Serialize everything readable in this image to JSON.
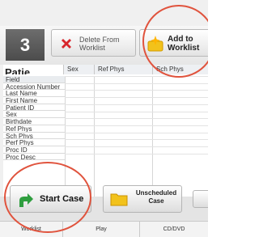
{
  "step_number": "3",
  "toolbar": {
    "delete_label_line1": "Delete From",
    "delete_label_line2": "Worklist",
    "add_label_line1": "Add to",
    "add_label_line2": "Worklist"
  },
  "grid": {
    "title": "Patie",
    "columns": [
      "Sex",
      "Ref Phys",
      "Sch Phys"
    ],
    "fields": [
      "Field",
      "Accession Number",
      "Last Name",
      "First Name",
      "Patient ID",
      "Sex",
      "Birthdate",
      "Ref Phys",
      "Sch Phys",
      "Perf Phys",
      "Proc ID",
      "Proc Desc"
    ]
  },
  "actions": {
    "start_case": "Start Case",
    "unscheduled_line1": "Unscheduled",
    "unscheduled_line2": "Case"
  },
  "tabs": [
    "Worklist",
    "Play",
    "CD/DVD"
  ],
  "colors": {
    "highlight_circle": "#e0533d",
    "start_arrow": "#2f9e3f",
    "delete_x": "#d8262c",
    "folder": "#f2c21b"
  }
}
